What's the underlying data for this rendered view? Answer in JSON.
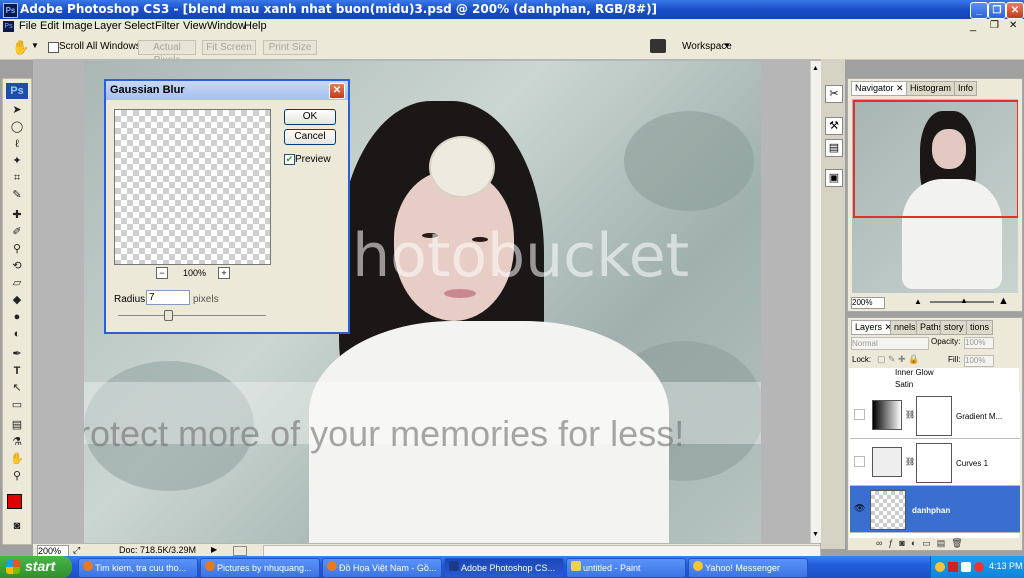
{
  "window": {
    "icon": "Ps",
    "title": "Adobe Photoshop CS3 - [blend mau xanh nhat buon(midu)3.psd @ 200% (danhphan, RGB/8#)]",
    "min_icon": "minimize-icon",
    "max_icon": "restore-icon",
    "close_icon": "close-icon"
  },
  "menu": [
    "File",
    "Edit",
    "Image",
    "Layer",
    "Select",
    "Filter",
    "View",
    "Window",
    "Help"
  ],
  "options": {
    "scroll_all": "Scroll All Windows",
    "actual_pixels": "Actual Pixels",
    "fit_screen": "Fit Screen",
    "print_size": "Print Size",
    "workspace": "Workspace"
  },
  "toolbox": {
    "logo": "Ps",
    "text_tool": "T",
    "foreground_color": "#e00000",
    "background_color": "#000000"
  },
  "dialog": {
    "title": "Gaussian Blur",
    "ok": "OK",
    "cancel": "Cancel",
    "preview_label": "Preview",
    "preview_checked": true,
    "zoom_minus": "−",
    "zoom": "100%",
    "zoom_plus": "+",
    "radius_label": "Radius:",
    "radius_value": "7",
    "radius_unit": "pixels",
    "radius_slider_fraction": 0.34
  },
  "status": {
    "zoom": "200%",
    "doc": "Doc: 718.5K/3.29M"
  },
  "navigator": {
    "tabs": [
      "Navigator",
      "Histogram",
      "Info"
    ],
    "zoom": "200%"
  },
  "layers": {
    "tabs": [
      "Layers",
      "nnels",
      "Paths",
      "story",
      "tions"
    ],
    "blend_mode": "Normal",
    "opacity_label": "Opacity:",
    "opacity": "100%",
    "lock_label": "Lock:",
    "fill_label": "Fill:",
    "fill": "100%",
    "effects": [
      "Inner Glow",
      "Satin"
    ],
    "rows": [
      {
        "name": "Gradient M..."
      },
      {
        "name": "Curves 1"
      },
      {
        "name": "danhphan"
      }
    ]
  },
  "taskbar": {
    "start": "start",
    "tasks": [
      "Tim kiem, tra cuu tho...",
      "Pictures by nhuquang...",
      "Đồ Họa Việt Nam - Gồ...",
      "Adobe Photoshop CS...",
      "untitled - Paint",
      "Yahoo! Messenger"
    ],
    "time": "4:13 PM"
  },
  "watermark": {
    "brand": "photobucket",
    "tagline": "Protect more of your memories for less!"
  },
  "colors": {
    "accent": "#316ac5",
    "selected_layer": "#3a6fd0"
  }
}
